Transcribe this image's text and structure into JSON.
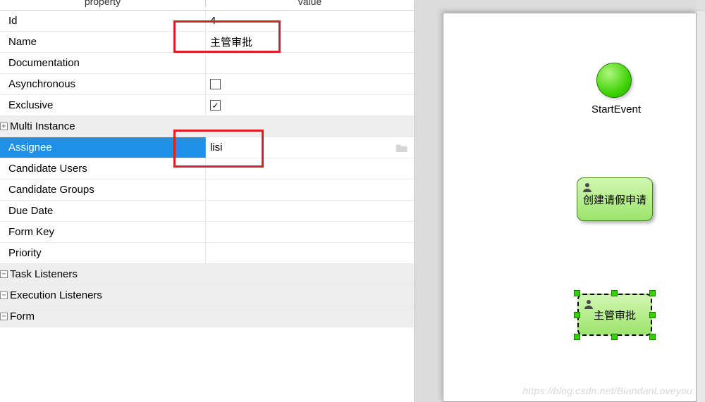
{
  "headers": {
    "property": "property",
    "value": "value"
  },
  "rows": {
    "id": {
      "label": "Id",
      "value": "4"
    },
    "name": {
      "label": "Name",
      "value": "主管审批"
    },
    "documentation": {
      "label": "Documentation",
      "value": ""
    },
    "async": {
      "label": "Asynchronous",
      "checked": false
    },
    "exclusive": {
      "label": "Exclusive",
      "checked": true
    },
    "multi": {
      "label": "Multi Instance"
    },
    "assignee": {
      "label": "Assignee",
      "value": "lisi"
    },
    "candUsers": {
      "label": "Candidate Users",
      "value": ""
    },
    "candGroups": {
      "label": "Candidate Groups",
      "value": ""
    },
    "dueDate": {
      "label": "Due Date",
      "value": ""
    },
    "formKey": {
      "label": "Form Key",
      "value": ""
    },
    "priority": {
      "label": "Priority",
      "value": ""
    },
    "taskListeners": {
      "label": "Task Listeners"
    },
    "execListeners": {
      "label": "Execution Listeners"
    },
    "form": {
      "label": "Form"
    }
  },
  "expanders": {
    "plus": "+",
    "minus": "−"
  },
  "checkbox": {
    "checkmark": "✓"
  },
  "diagram": {
    "startLabel": "StartEvent",
    "task1": "创建请假申请",
    "task2": "主管审批"
  },
  "watermark": "https://blog.csdn.net/BiandanLoveyou"
}
